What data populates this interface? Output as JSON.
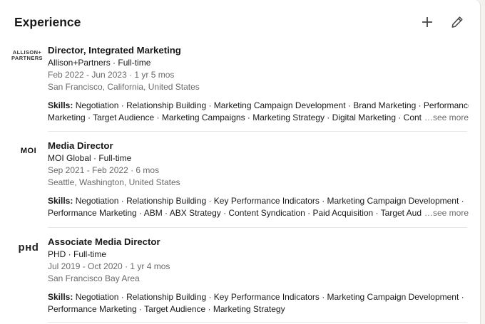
{
  "section": {
    "title": "Experience"
  },
  "header_icons": {
    "add": "plus-icon",
    "edit": "pencil-icon"
  },
  "entries": [
    {
      "logo_text": "ALLISON+ PARTNERS",
      "role": "Director, Integrated Marketing",
      "company": "Allison+Partners · Full-time",
      "dates": "Feb 2022 - Jun 2023 · 1 yr 5 mos",
      "location": "San Francisco, California, United States",
      "skills_label": "Skills:",
      "skills_line1": " Negotiation · Relationship Building · Marketing Campaign Development · Brand Marketing · Performance",
      "skills_line2": "Marketing · Target Audience · Marketing Campaigns · Marketing Strategy · Digital Marketing · Conter",
      "see_more": "…see more"
    },
    {
      "logo_text": "MOI",
      "role": "Media Director",
      "company": "MOI Global · Full-time",
      "dates": "Sep 2021 - Feb 2022 · 6 mos",
      "location": "Seattle, Washington, United States",
      "skills_label": "Skills:",
      "skills_line1": " Negotiation · Relationship Building · Key Performance Indicators · Marketing Campaign Development ·",
      "skills_line2": "Performance Marketing · ABM · ABX Strategy · Content Syndication · Paid Acquisition · Target Audier",
      "see_more": "…see more"
    },
    {
      "logo_text": "PHD",
      "role": "Associate Media Director",
      "company": "PHD · Full-time",
      "dates": "Jul 2019 - Oct 2020 · 1 yr 4 mos",
      "location": "San Francisco Bay Area",
      "skills_label": "Skills:",
      "skills_line1": " Negotiation · Relationship Building · Key Performance Indicators · Marketing Campaign Development ·",
      "skills_line2": "Performance Marketing · Target Audience · Marketing Strategy"
    }
  ]
}
